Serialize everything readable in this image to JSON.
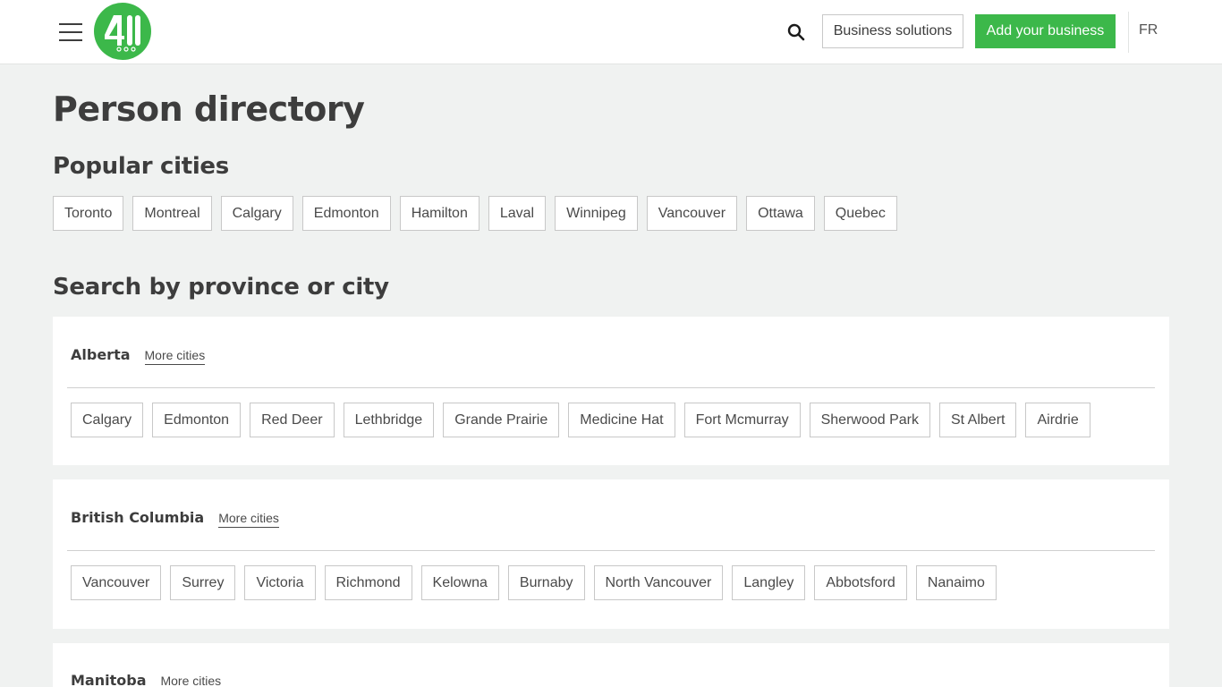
{
  "header": {
    "business_solutions": "Business solutions",
    "add_business": "Add your business",
    "lang": "FR",
    "brand_color": "#3cb84a",
    "logo_text": "411"
  },
  "page": {
    "title": "Person directory",
    "popular_title": "Popular cities",
    "search_title": "Search by province or city"
  },
  "popular_cities": [
    "Toronto",
    "Montreal",
    "Calgary",
    "Edmonton",
    "Hamilton",
    "Laval",
    "Winnipeg",
    "Vancouver",
    "Ottawa",
    "Quebec"
  ],
  "provinces": [
    {
      "name": "Alberta",
      "more": "More cities",
      "cities": [
        "Calgary",
        "Edmonton",
        "Red Deer",
        "Lethbridge",
        "Grande Prairie",
        "Medicine Hat",
        "Fort Mcmurray",
        "Sherwood Park",
        "St Albert",
        "Airdrie"
      ]
    },
    {
      "name": "British Columbia",
      "more": "More cities",
      "cities": [
        "Vancouver",
        "Surrey",
        "Victoria",
        "Richmond",
        "Kelowna",
        "Burnaby",
        "North Vancouver",
        "Langley",
        "Abbotsford",
        "Nanaimo"
      ]
    },
    {
      "name": "Manitoba",
      "more": "More cities",
      "cities": []
    }
  ]
}
